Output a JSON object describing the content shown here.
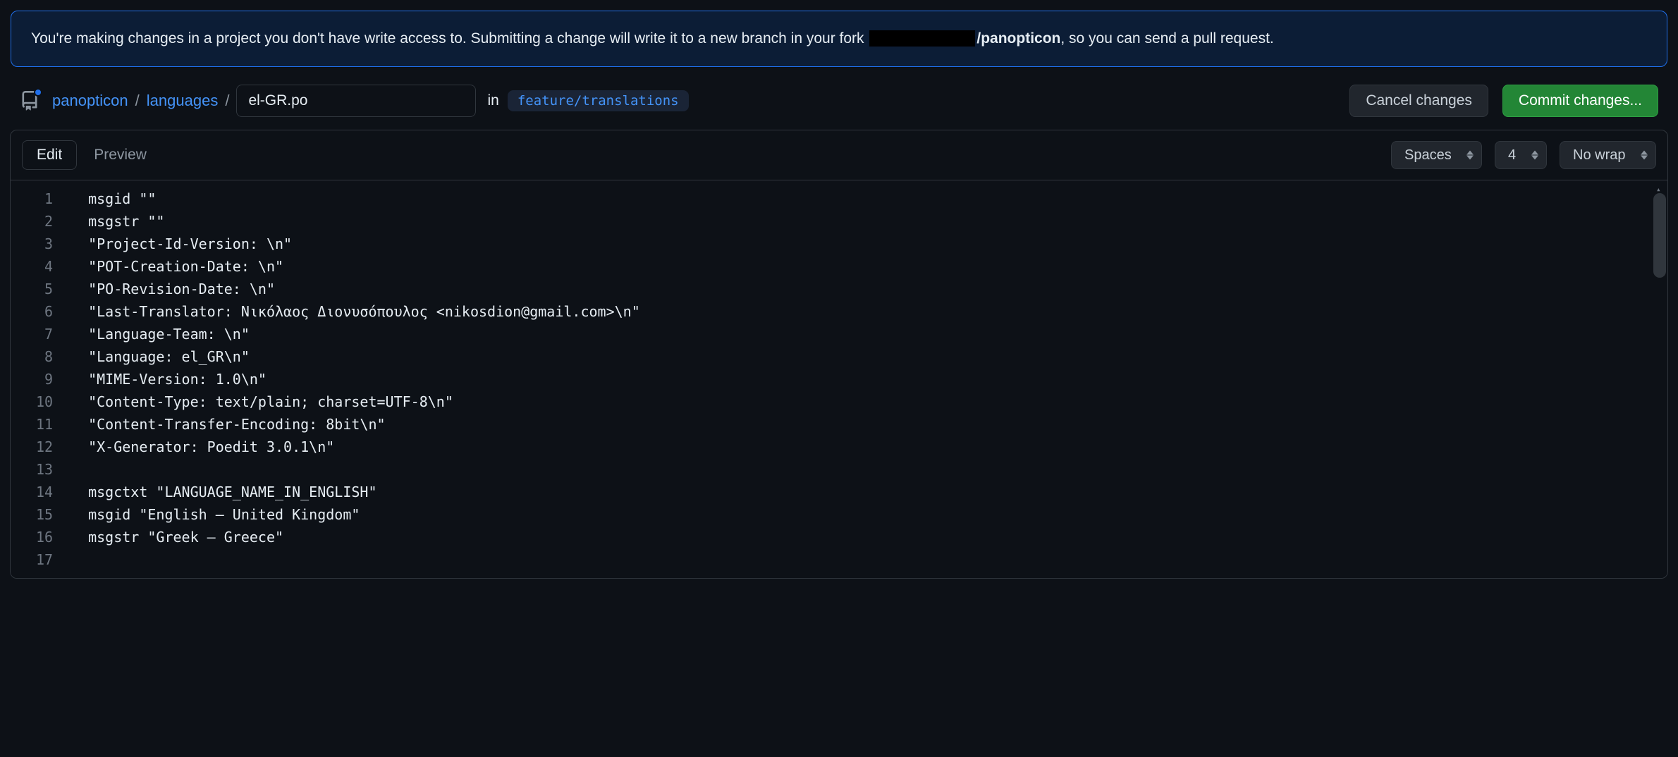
{
  "notice": {
    "prefix": "You're making changes in a project you don't have write access to. Submitting a change will write it to a new branch in your fork ",
    "fork_suffix": "/panopticon",
    "suffix": ", so you can send a pull request."
  },
  "path": {
    "repo": "panopticon",
    "dir": "languages",
    "filename": "el-GR.po",
    "in_label": "in",
    "branch": "feature/translations"
  },
  "actions": {
    "cancel": "Cancel changes",
    "commit": "Commit changes..."
  },
  "tabs": {
    "edit": "Edit",
    "preview": "Preview"
  },
  "toolbar": {
    "indent_mode": "Spaces",
    "indent_size": "4",
    "wrap_mode": "No wrap"
  },
  "code": {
    "lines": [
      "msgid \"\"",
      "msgstr \"\"",
      "\"Project-Id-Version: \\n\"",
      "\"POT-Creation-Date: \\n\"",
      "\"PO-Revision-Date: \\n\"",
      "\"Last-Translator: Νικόλαος Διονυσόπουλος <nikosdion@gmail.com>\\n\"",
      "\"Language-Team: \\n\"",
      "\"Language: el_GR\\n\"",
      "\"MIME-Version: 1.0\\n\"",
      "\"Content-Type: text/plain; charset=UTF-8\\n\"",
      "\"Content-Transfer-Encoding: 8bit\\n\"",
      "\"X-Generator: Poedit 3.0.1\\n\"",
      "",
      "msgctxt \"LANGUAGE_NAME_IN_ENGLISH\"",
      "msgid \"English – United Kingdom\"",
      "msgstr \"Greek – Greece\"",
      ""
    ],
    "line_numbers": [
      "1",
      "2",
      "3",
      "4",
      "5",
      "6",
      "7",
      "8",
      "9",
      "10",
      "11",
      "12",
      "13",
      "14",
      "15",
      "16",
      "17"
    ]
  }
}
